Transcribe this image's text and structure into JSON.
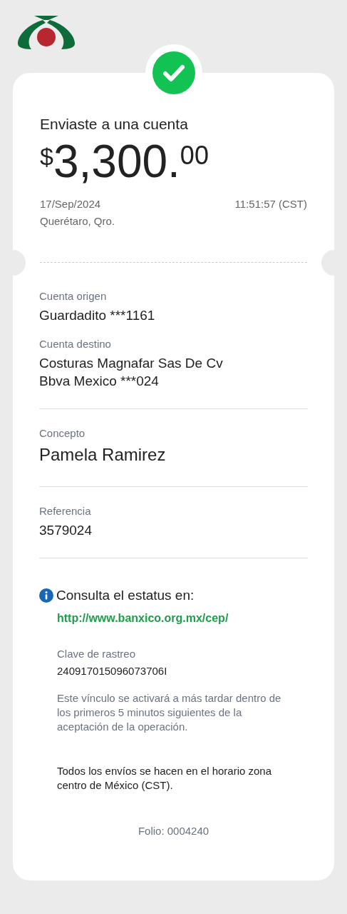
{
  "receipt": {
    "title": "Enviaste a una cuenta",
    "amount": {
      "currency": "$",
      "integer": "3,300",
      "separator": ".",
      "cents": "00"
    },
    "date": "17/Sep/2024",
    "time": "11:51:57 (CST)",
    "location": "Querétaro, Qro."
  },
  "sections": [
    {
      "fields": [
        {
          "label": "Cuenta origen",
          "lines": [
            "Guardadito ***1161"
          ]
        },
        {
          "label": "Cuenta destino",
          "lines": [
            "Costuras Magnafar Sas De Cv",
            "Bbva Mexico ***024"
          ]
        }
      ]
    },
    {
      "fields": [
        {
          "label": "Concepto",
          "lines": [
            "Pamela Ramirez"
          ],
          "large": true
        }
      ]
    },
    {
      "fields": [
        {
          "label": "Referencia",
          "lines": [
            "3579024"
          ]
        }
      ]
    }
  ],
  "status_info": {
    "heading": "Consulta el estatus en:",
    "link": "http://www.banxico.org.mx/cep/",
    "tracking_label": "Clave de rastreo",
    "tracking_value": "240917015096073706I",
    "note": "Este vínculo se activará a más tardar dentro de los primeros 5 minutos siguientes de la aceptación de la operación."
  },
  "disclaimer": "Todos los envíos se hacen en el horario zona centro de México (CST).",
  "folio": "Folio: 0004240"
}
